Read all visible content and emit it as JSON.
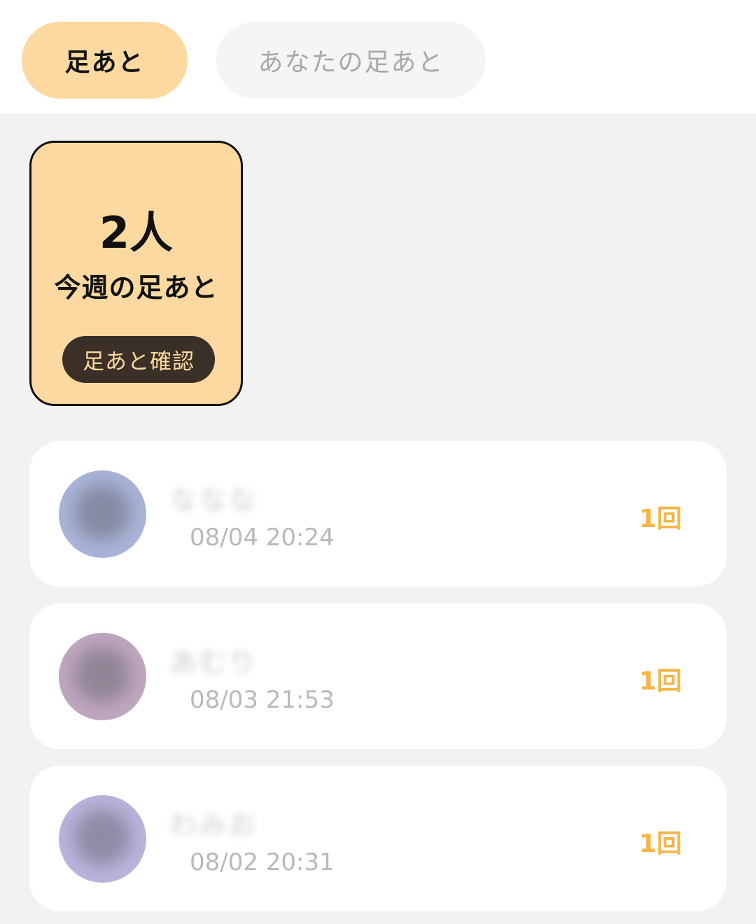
{
  "tabs": [
    {
      "label": "足あと",
      "active": true
    },
    {
      "label": "あなたの足あと",
      "active": false
    }
  ],
  "summary": {
    "count": "2人",
    "label": "今週の足あと",
    "button": "足あと確認"
  },
  "visitors": [
    {
      "name": "ななな",
      "time": "08/04 20:24",
      "visits": "1回",
      "avatar_color": "#a9b4d8"
    },
    {
      "name": "あむり",
      "time": "08/03 21:53",
      "visits": "1回",
      "avatar_color": "#bfa7bf"
    },
    {
      "name": "わみお",
      "time": "08/02 20:31",
      "visits": "1回",
      "avatar_color": "#bbb3db"
    }
  ],
  "colors": {
    "accent": "#fcd9a0",
    "visits": "#f6b444",
    "dark_button": "#3a3027"
  }
}
